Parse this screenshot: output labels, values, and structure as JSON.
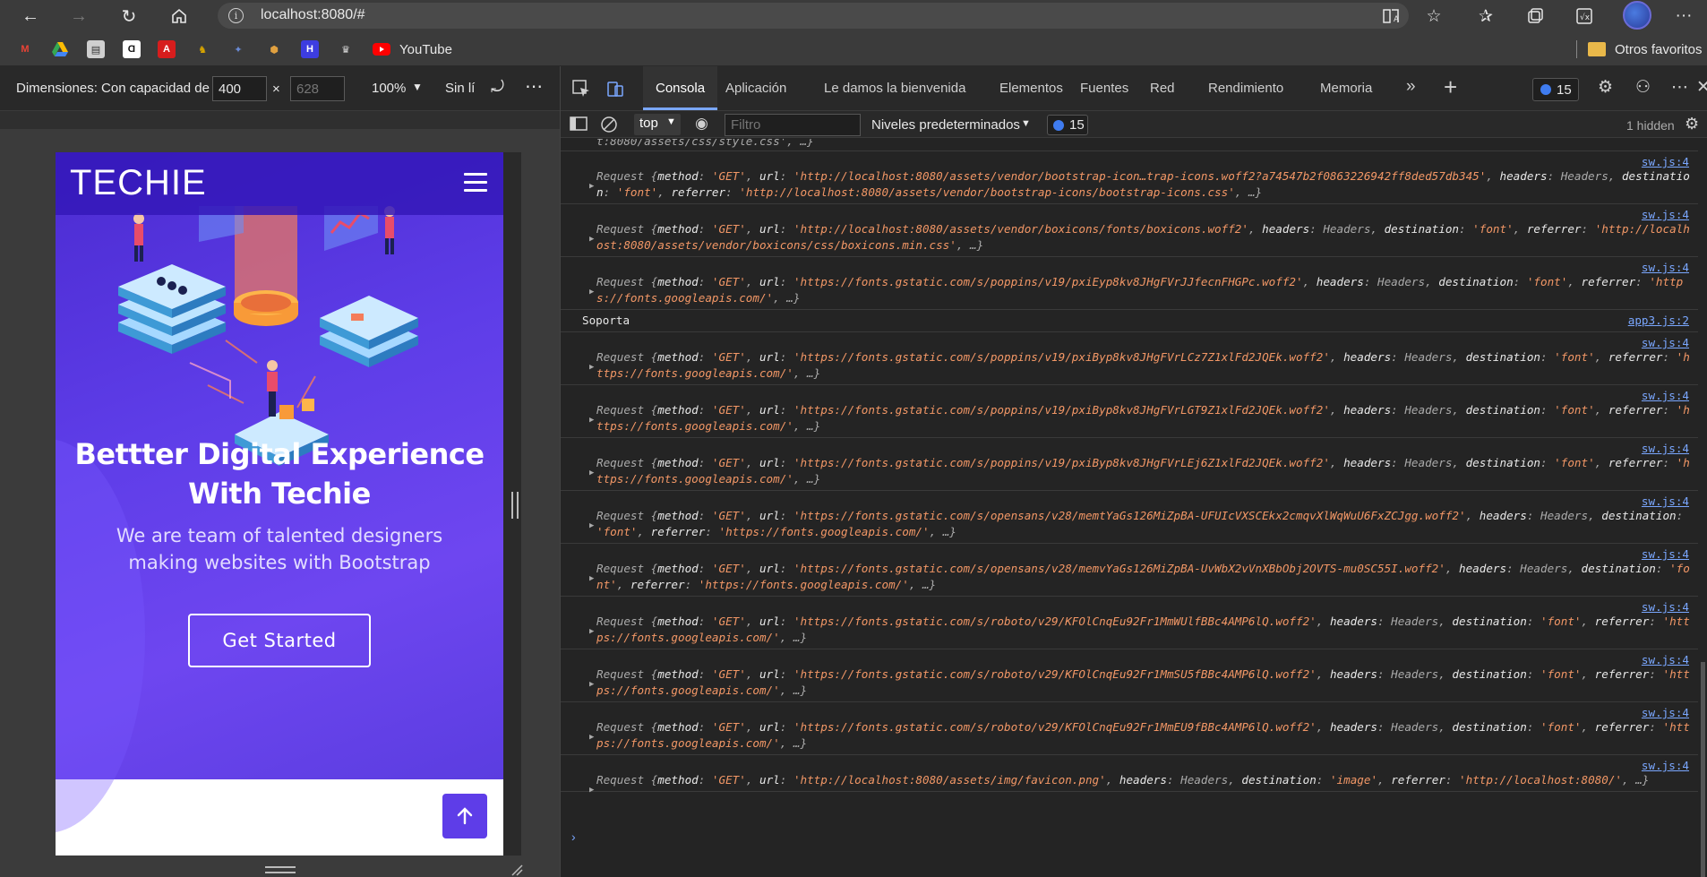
{
  "browser": {
    "url": "localhost:8080/#",
    "back_icon": "arrow-left-icon",
    "forward_icon": "arrow-right-icon",
    "reload_icon": "reload-icon",
    "home_icon": "home-icon"
  },
  "bookmarks": {
    "items": [
      {
        "name": "gmail",
        "color": "#ea4335"
      },
      {
        "name": "drive",
        "color": "#34a853"
      },
      {
        "name": "bookmark-3",
        "color": "#cfcfcf"
      },
      {
        "name": "bookmark-4",
        "color": "#2b2b2b"
      },
      {
        "name": "adobe",
        "color": "#d71d1d"
      },
      {
        "name": "bookmark-6",
        "color": "#d6a300"
      },
      {
        "name": "bookmark-7",
        "color": "#6a8bd6"
      },
      {
        "name": "bookmark-8",
        "color": "#e0a040"
      },
      {
        "name": "bookmark-9",
        "color": "#3d3de0"
      },
      {
        "name": "bookmark-10",
        "color": "#1b1b1b"
      }
    ],
    "youtube_label": "YouTube",
    "other_label": "Otros favoritos"
  },
  "device_toolbar": {
    "dimensions_label": "Dimensiones: Con capacidad de",
    "width_value": "400",
    "height_placeholder": "628",
    "x_sep": "×",
    "zoom": "100%",
    "throttle": "Sin límite"
  },
  "site": {
    "logo": "TECHIE",
    "title": "Bettter Digital Experience With Techie",
    "subtitle": "We are team of talented designers making websites with Bootstrap",
    "cta": "Get Started"
  },
  "devtools": {
    "tabs": [
      {
        "label": "Consola",
        "active": true
      },
      {
        "label": "Aplicación"
      },
      {
        "label": "Le damos la bienvenida"
      },
      {
        "label": "Elementos"
      },
      {
        "label": "Fuentes"
      },
      {
        "label": "Red"
      },
      {
        "label": "Rendimiento"
      },
      {
        "label": "Memoria"
      }
    ],
    "issues_count": "15",
    "context": "top",
    "filter_placeholder": "Filtro",
    "levels": "Niveles predeterminados",
    "msg_count": "15",
    "hidden": "1 hidden"
  },
  "console": {
    "truncated_top": "t:8080/assets/css/style.css', …}",
    "entries": [
      {
        "src": "sw.js:4",
        "url": "http://localhost:8080/assets/vendor/bootstrap-icon…trap-icons.woff2?a74547b2f0863226942ff8ded57db345",
        "dest": "font",
        "ref": "http://localhost:8080/assets/vendor/bootstrap-icons/bootstrap-icons.css"
      },
      {
        "src": "sw.js:4",
        "url": "http://localhost:8080/assets/vendor/boxicons/fonts/boxicons.woff2",
        "dest": "font",
        "ref": "http://localhost:8080/assets/vendor/boxicons/css/boxicons.min.css"
      },
      {
        "src": "sw.js:4",
        "url": "https://fonts.gstatic.com/s/poppins/v19/pxiEyp8kv8JHgFVrJJfecnFHGPc.woff2",
        "dest": "font",
        "ref": "https://fonts.googleapis.com/"
      },
      {
        "plain": "Soporta",
        "src": "app3.js:2"
      },
      {
        "src": "sw.js:4",
        "url": "https://fonts.gstatic.com/s/poppins/v19/pxiByp8kv8JHgFVrLCz7Z1xlFd2JQEk.woff2",
        "dest": "font",
        "ref": "https://fonts.googleapis.com/"
      },
      {
        "src": "sw.js:4",
        "url": "https://fonts.gstatic.com/s/poppins/v19/pxiByp8kv8JHgFVrLGT9Z1xlFd2JQEk.woff2",
        "dest": "font",
        "ref": "https://fonts.googleapis.com/"
      },
      {
        "src": "sw.js:4",
        "url": "https://fonts.gstatic.com/s/poppins/v19/pxiByp8kv8JHgFVrLEj6Z1xlFd2JQEk.woff2",
        "dest": "font",
        "ref": "https://fonts.googleapis.com/"
      },
      {
        "src": "sw.js:4",
        "url": "https://fonts.gstatic.com/s/opensans/v28/memtYaGs126MiZpBA-UFUIcVXSCEkx2cmqvXlWqWuU6FxZCJgg.woff2",
        "dest": "font",
        "ref": "https://fonts.googleapis.com/"
      },
      {
        "src": "sw.js:4",
        "url": "https://fonts.gstatic.com/s/opensans/v28/memvYaGs126MiZpBA-UvWbX2vVnXBbObj2OVTS-mu0SC55I.woff2",
        "dest": "font",
        "ref": "https://fonts.googleapis.com/"
      },
      {
        "src": "sw.js:4",
        "url": "https://fonts.gstatic.com/s/roboto/v29/KFOlCnqEu92Fr1MmWUlfBBc4AMP6lQ.woff2",
        "dest": "font",
        "ref": "https://fonts.googleapis.com/"
      },
      {
        "src": "sw.js:4",
        "url": "https://fonts.gstatic.com/s/roboto/v29/KFOlCnqEu92Fr1MmSU5fBBc4AMP6lQ.woff2",
        "dest": "font",
        "ref": "https://fonts.googleapis.com/"
      },
      {
        "src": "sw.js:4",
        "url": "https://fonts.gstatic.com/s/roboto/v29/KFOlCnqEu92Fr1MmEU9fBBc4AMP6lQ.woff2",
        "dest": "font",
        "ref": "https://fonts.googleapis.com/"
      },
      {
        "src": "sw.js:4",
        "url": "http://localhost:8080/assets/img/favicon.png",
        "dest": "image",
        "ref": "http://localhost:8080/"
      }
    ]
  }
}
